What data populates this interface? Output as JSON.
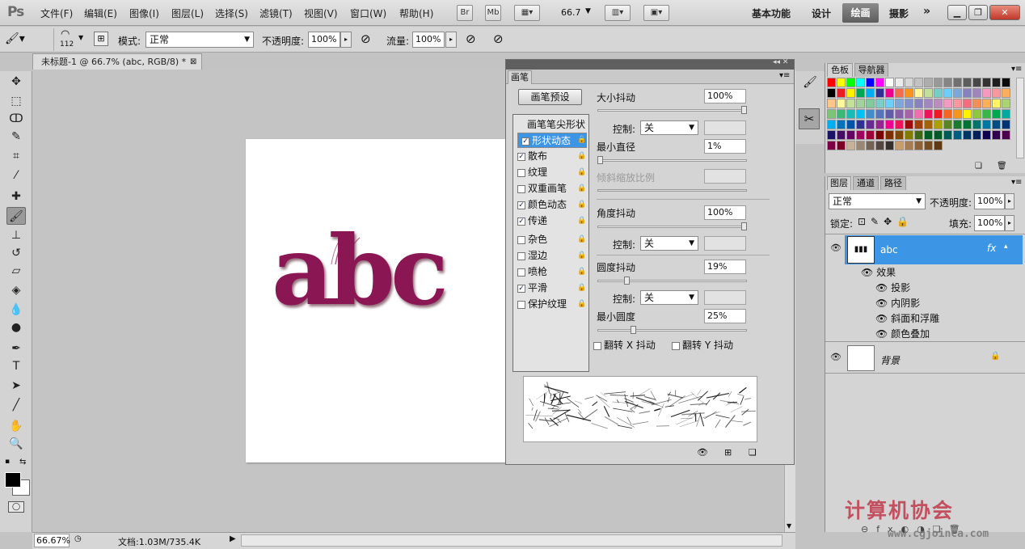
{
  "app": {
    "logo": "Ps"
  },
  "menu": [
    "文件(F)",
    "编辑(E)",
    "图像(I)",
    "图层(L)",
    "选择(S)",
    "滤镜(T)",
    "视图(V)",
    "窗口(W)",
    "帮助(H)"
  ],
  "appbar": {
    "br": "Br",
    "mb": "Mb",
    "zoom": "66.7"
  },
  "workspaces": [
    "基本功能",
    "设计",
    "绘画",
    "摄影"
  ],
  "workspace_active": "绘画",
  "options": {
    "brush_size": "112",
    "mode_label": "模式:",
    "mode_value": "正常",
    "opacity_label": "不透明度:",
    "opacity_value": "100%",
    "flow_label": "流量:",
    "flow_value": "100%"
  },
  "document": {
    "tab_title": "未标题-1 @ 66.7% (abc, RGB/8) *",
    "canvas_text": "abc",
    "text_color": "#8b1654"
  },
  "status": {
    "zoom": "66.67%",
    "doc": "文档:1.03M/735.4K"
  },
  "brush_panel": {
    "tab": "画笔",
    "preset_button": "画笔预设",
    "tip_shape": "画笔笔尖形状",
    "options": [
      {
        "label": "形状动态",
        "checked": true,
        "selected": true
      },
      {
        "label": "散布",
        "checked": true
      },
      {
        "label": "纹理",
        "checked": false
      },
      {
        "label": "双重画笔",
        "checked": false
      },
      {
        "label": "颜色动态",
        "checked": true
      },
      {
        "label": "传递",
        "checked": true
      },
      {
        "label": "杂色",
        "checked": false
      },
      {
        "label": "湿边",
        "checked": false
      },
      {
        "label": "喷枪",
        "checked": false
      },
      {
        "label": "平滑",
        "checked": true
      },
      {
        "label": "保护纹理",
        "checked": false
      }
    ],
    "size_jitter_label": "大小抖动",
    "size_jitter": "100%",
    "control_label": "控制:",
    "control_off": "关",
    "min_diameter_label": "最小直径",
    "min_diameter": "1%",
    "tilt_scale_label": "倾斜缩放比例",
    "angle_jitter_label": "角度抖动",
    "angle_jitter": "100%",
    "roundness_jitter_label": "圆度抖动",
    "roundness_jitter": "19%",
    "min_roundness_label": "最小圆度",
    "min_roundness": "25%",
    "flip_x": "翻转 X 抖动",
    "flip_y": "翻转 Y 抖动"
  },
  "swatches_panel": {
    "tabs": [
      "色板",
      "导航器"
    ],
    "colors": [
      "#ff0000",
      "#ffff00",
      "#00ff00",
      "#00ffff",
      "#0000ff",
      "#ff00ff",
      "#ffffff",
      "#ebebeb",
      "#d6d6d6",
      "#c2c2c2",
      "#adadad",
      "#999999",
      "#858585",
      "#707070",
      "#5c5c5c",
      "#474747",
      "#333333",
      "#1f1f1f",
      "#0a0a0a",
      "#000000",
      "#ed1c24",
      "#fff200",
      "#00a651",
      "#00aeef",
      "#2e3192",
      "#ec008c",
      "#f26c4f",
      "#f7941d",
      "#fff799",
      "#c4df9b",
      "#7accc8",
      "#6dcff6",
      "#7da7d9",
      "#8781bd",
      "#a186be",
      "#f49ac1",
      "#f6989d",
      "#fbaf5d",
      "#fdc68a",
      "#fff79a",
      "#c4df9b",
      "#a3d39c",
      "#82ca9c",
      "#7bcdc8",
      "#6ecff6",
      "#7ea7d8",
      "#8393ca",
      "#8882be",
      "#a187be",
      "#bc8cbf",
      "#f49bc1",
      "#f5989d",
      "#f26d7d",
      "#f68e56",
      "#fbaf5c",
      "#fff468",
      "#acd373",
      "#7cc576",
      "#3bb878",
      "#1abbb4",
      "#00bff3",
      "#438ccb",
      "#5574b9",
      "#605ca8",
      "#855fa8",
      "#a763a8",
      "#f06ea9",
      "#ed145b",
      "#ed1c24",
      "#f26522",
      "#f7941d",
      "#fff200",
      "#8dc63f",
      "#39b54a",
      "#00a651",
      "#00a99d",
      "#00aeef",
      "#0072bc",
      "#0054a6",
      "#2e3192",
      "#662d91",
      "#92278f",
      "#ec008c",
      "#ed145b",
      "#9e0b0f",
      "#a0410d",
      "#a36209",
      "#aba000",
      "#598527",
      "#1a7b30",
      "#007236",
      "#00746b",
      "#0076a3",
      "#004b80",
      "#003471",
      "#1b1464",
      "#440e62",
      "#630460",
      "#9e005d",
      "#9e0039",
      "#790000",
      "#7b2e00",
      "#7d4900",
      "#827b00",
      "#406618",
      "#005e20",
      "#005826",
      "#005952",
      "#005b7f",
      "#003663",
      "#002157",
      "#0d004c",
      "#32004b",
      "#4b0049",
      "#7b0046",
      "#7a0026",
      "#c7b299",
      "#998675",
      "#736357",
      "#534741",
      "#37302a",
      "#c69c6d",
      "#a67c52",
      "#8c6239",
      "#754c24",
      "#603913"
    ]
  },
  "layers_panel": {
    "tabs": [
      "图层",
      "通道",
      "路径"
    ],
    "blend_mode": "正常",
    "opacity_label": "不透明度:",
    "opacity_value": "100%",
    "lock_label": "锁定:",
    "fill_label": "填充:",
    "fill_value": "100%",
    "layers": [
      {
        "name": "abc",
        "fx": "fx",
        "effects_label": "效果",
        "effects": [
          "投影",
          "内阴影",
          "斜面和浮雕",
          "颜色叠加"
        ]
      },
      {
        "name": "背景"
      }
    ]
  },
  "watermark": {
    "text": "计算机协会",
    "url": "www.cgjoinca.com"
  }
}
